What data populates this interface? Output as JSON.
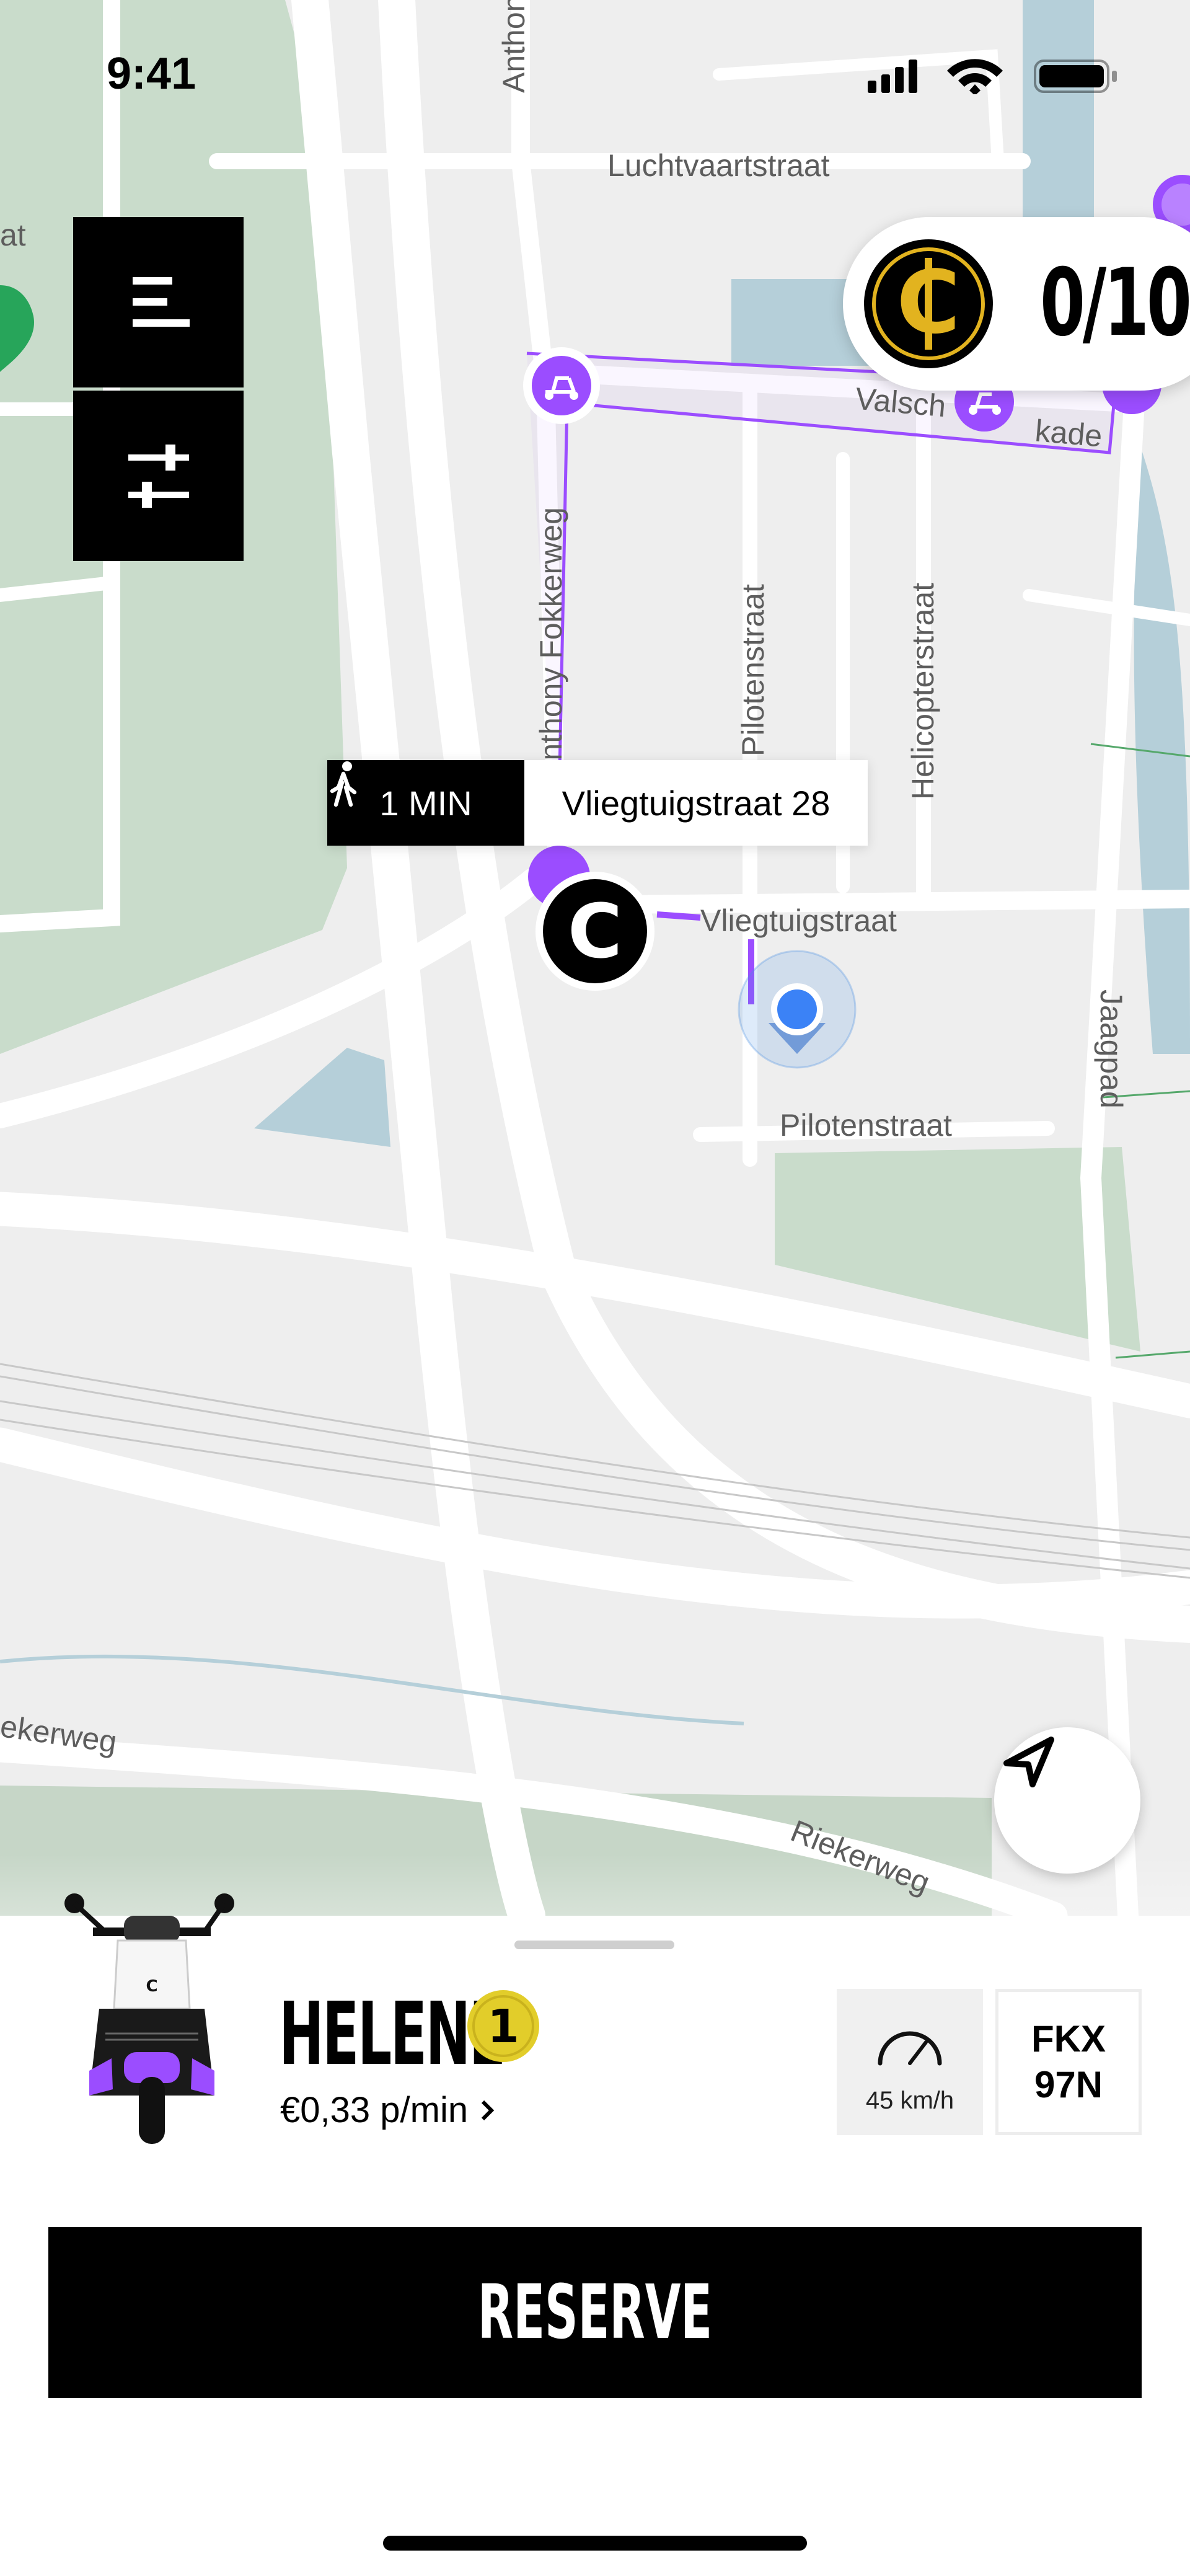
{
  "status_bar": {
    "time": "9:41",
    "icons": [
      "cellular-signal-icon",
      "wifi-icon",
      "battery-icon"
    ]
  },
  "map": {
    "streets": {
      "luchtvaartstraat": "Luchtvaartstraat",
      "anthony_top": "Anthony F",
      "anthony_fokkerweg": "Anthony Fokkerweg",
      "valschermkade_a": "Valsch",
      "valschermkade_b": "kade",
      "pilotenstraat_vertical": "Pilotenstraat",
      "helicopterstraat": "Helicopterstraat",
      "vliegtuigstraat": "Vliegtuigstraat",
      "jaagpad": "Jaagpad",
      "pilotenstraat": "Pilotenstraat",
      "riekerweg_left": "ekerweg",
      "riekerweg_right": "Riekerweg",
      "edge_left": "at"
    },
    "walk_badge": {
      "time": "1 MIN",
      "address": "Vliegtuigstraat 28"
    },
    "selected_marker_label": "C"
  },
  "coins": {
    "count": "0/10"
  },
  "vehicle": {
    "name": "HELENE",
    "level": "1",
    "price": "€0,33 p/min",
    "speed": "45 km/h",
    "plate_line1": "FKX",
    "plate_line2": "97N"
  },
  "actions": {
    "reserve_label": "RESERVE"
  },
  "colors": {
    "accent_purple": "#9b4dff",
    "park_green": "#c9dccb",
    "water_blue": "#b5cfd9",
    "coin_gold": "#e2b31f"
  }
}
